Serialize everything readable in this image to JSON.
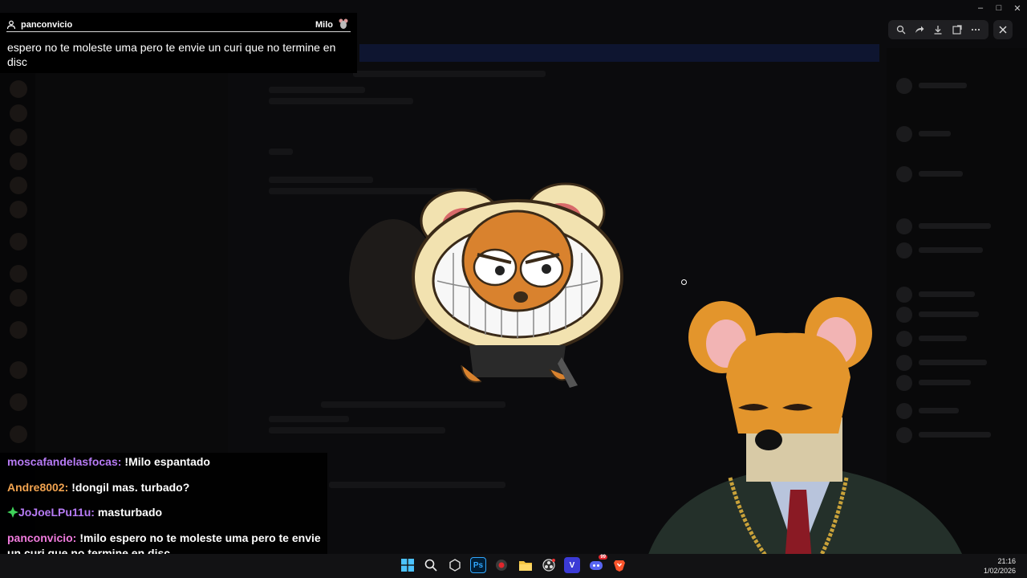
{
  "window": {
    "title": "",
    "controls": [
      "minimize",
      "maximize",
      "close"
    ]
  },
  "viewer_toolbar": {
    "tools": [
      "zoom-icon",
      "forward-icon",
      "download-icon",
      "open-external-icon",
      "more-icon"
    ],
    "close": "close-icon"
  },
  "highlighted_message": {
    "username": "panconvicio",
    "target": "Milo",
    "text": "espero no te moleste uma pero te envie un curi que no termine en disc"
  },
  "chat": [
    {
      "name": "moscafandelasfocas:",
      "text": "!Milo espantado",
      "color": "#b77bf5",
      "badge": ""
    },
    {
      "name": "Andre8002:",
      "text": "!dongil mas. turbado?",
      "color": "#f1a350",
      "badge": ""
    },
    {
      "name": "JoJoeLPu11u:",
      "text": "masturbado",
      "color": "#b77bf5",
      "badge": "green-diamond-icon"
    },
    {
      "name": "panconvicio:",
      "text": "!milo espero no te moleste uma pero te envie un curi que no termine en disc",
      "color": "#f07bdd",
      "badge": ""
    }
  ],
  "taskbar": {
    "icons": [
      "windows-start-icon",
      "search-icon",
      "app-icon",
      "photoshop-icon",
      "record-icon",
      "file-explorer-icon",
      "obs-icon",
      "vegas-icon",
      "discord-icon",
      "brave-icon"
    ],
    "photoshop_label": "Ps",
    "vegas_label": "V",
    "discord_badge": "99",
    "time": "21:16",
    "date": "1/02/2026"
  },
  "colors": {
    "accent_purple": "#b77bf5",
    "accent_orange": "#f1a350",
    "accent_pink": "#f07bdd"
  }
}
